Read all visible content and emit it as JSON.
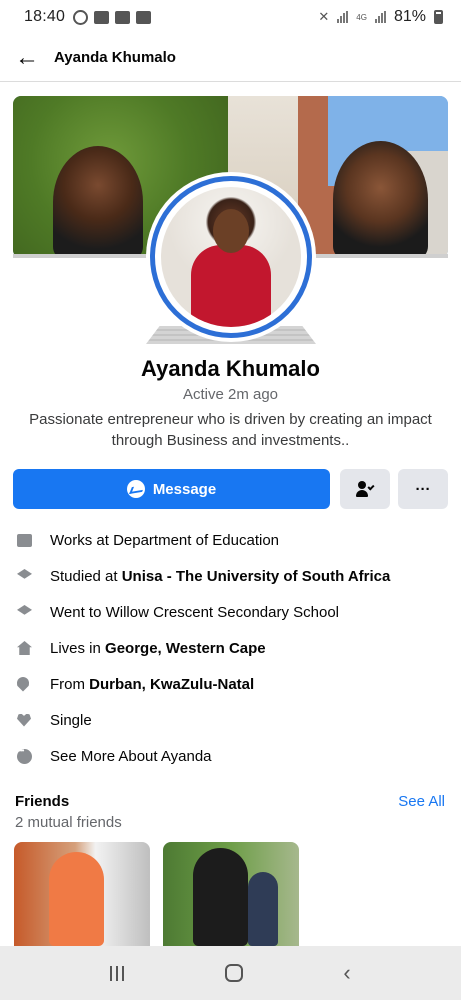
{
  "status_bar": {
    "time": "18:40",
    "battery": "81%",
    "network_label": "4G"
  },
  "header": {
    "title": "Ayanda Khumalo"
  },
  "profile": {
    "name": "Ayanda Khumalo",
    "active_status": "Active 2m ago",
    "bio": "Passionate entrepreneur who is driven by creating an impact through Business and investments.."
  },
  "actions": {
    "message_label": "Message",
    "more_label": "···"
  },
  "details": [
    {
      "icon": "briefcase-icon",
      "prefix": "Works at Department of Education",
      "bold": ""
    },
    {
      "icon": "graduation-cap-icon",
      "prefix": "Studied at ",
      "bold": "Unisa - The University of South Africa"
    },
    {
      "icon": "graduation-cap-icon",
      "prefix": "Went to Willow Crescent Secondary School",
      "bold": ""
    },
    {
      "icon": "home-icon",
      "prefix": "Lives in ",
      "bold": "George, Western Cape"
    },
    {
      "icon": "location-pin-icon",
      "prefix": "From ",
      "bold": "Durban, KwaZulu-Natal"
    },
    {
      "icon": "heart-icon",
      "prefix": "Single",
      "bold": ""
    },
    {
      "icon": "more-dots-icon",
      "prefix": "See More About Ayanda",
      "bold": ""
    }
  ],
  "friends": {
    "title": "Friends",
    "see_all": "See All",
    "mutual": "2 mutual friends"
  },
  "colors": {
    "accent": "#1877f2",
    "avatar_ring": "#2d6fd6",
    "secondary_text": "#65676b"
  }
}
